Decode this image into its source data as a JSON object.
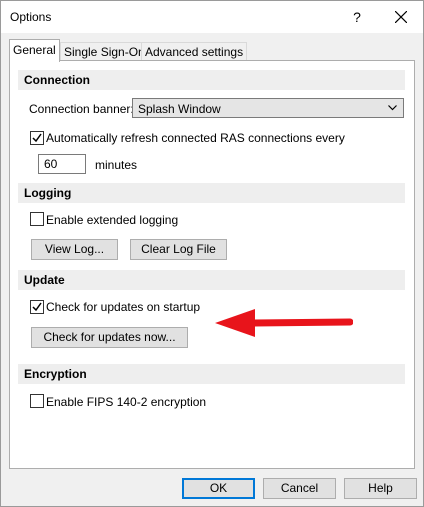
{
  "window": {
    "title": "Options",
    "help_label": "?"
  },
  "tabs": [
    {
      "label": "General",
      "active": true
    },
    {
      "label": "Single Sign-On",
      "active": false
    },
    {
      "label": "Advanced settings",
      "active": false
    }
  ],
  "connection": {
    "header": "Connection",
    "banner_label": "Connection banner:",
    "banner_value": "Splash Window",
    "auto_refresh_label": "Automatically refresh connected RAS connections every",
    "auto_refresh_checked": true,
    "refresh_value": "60",
    "refresh_unit": "minutes"
  },
  "logging": {
    "header": "Logging",
    "extended_label": "Enable extended logging",
    "extended_checked": false,
    "view_log": "View Log...",
    "clear_log": "Clear Log File"
  },
  "update": {
    "header": "Update",
    "startup_label": "Check for updates on startup",
    "startup_checked": true,
    "check_now": "Check for updates now..."
  },
  "encryption": {
    "header": "Encryption",
    "fips_label": "Enable FIPS 140-2 encryption",
    "fips_checked": false
  },
  "footer": {
    "ok": "OK",
    "cancel": "Cancel",
    "help": "Help"
  },
  "colors": {
    "arrow": "#e8141b",
    "default_button_border": "#0078d7"
  }
}
